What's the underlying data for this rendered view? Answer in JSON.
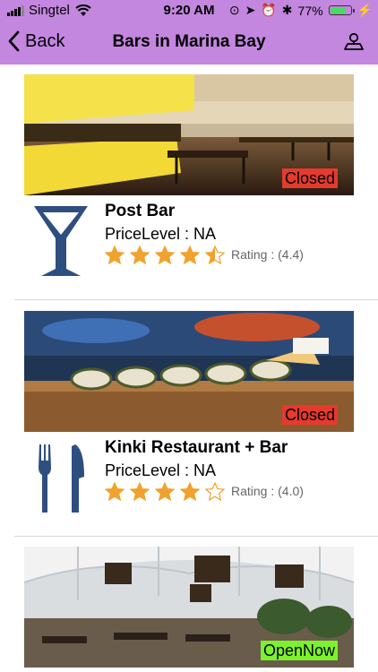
{
  "status_bar": {
    "carrier": "Singtel",
    "time": "9:20 AM",
    "battery": "77%",
    "battery_level": 0.77
  },
  "nav": {
    "back_label": "Back",
    "title": "Bars in Marina Bay"
  },
  "bars": [
    {
      "name": "Post Bar",
      "price_level": "PriceLevel : NA",
      "rating_text": "Rating : (4.4)",
      "stars": 4.5,
      "status": "Closed",
      "icon": "cocktail-glass-icon"
    },
    {
      "name": "Kinki Restaurant + Bar",
      "price_level": "PriceLevel : NA",
      "rating_text": "Rating : (4.0)",
      "stars": 4,
      "status": "Closed",
      "icon": "fork-knife-icon"
    },
    {
      "name": "",
      "status": "OpenNow"
    }
  ],
  "colors": {
    "nav_background": "#c387e0",
    "star": "#f0a22e",
    "closed_badge": "#e53a2c",
    "open_badge": "#7cf22c",
    "icon_blue": "#2f4e80"
  }
}
